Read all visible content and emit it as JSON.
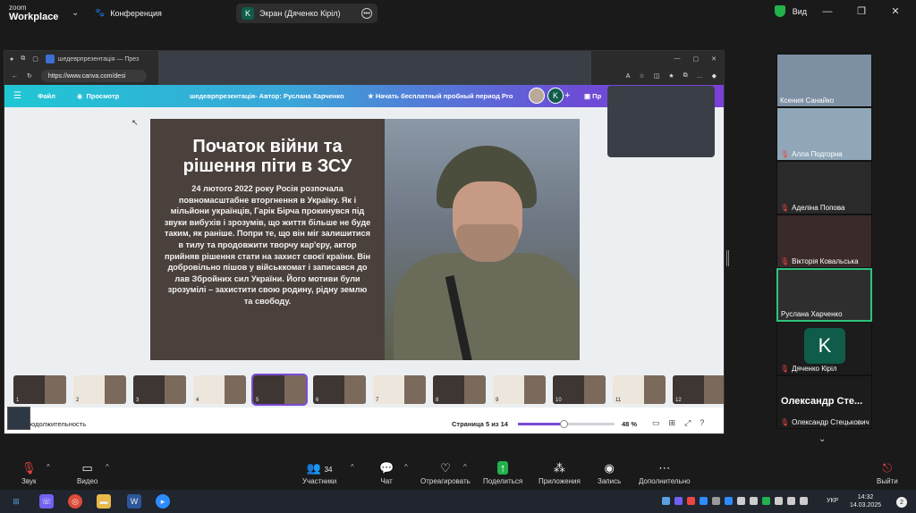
{
  "zoom": {
    "logo_top": "zoom",
    "logo_bottom": "Workplace",
    "meeting_label": "Конференция",
    "screen_share_label": "Экран (Дяченко Кіріл)",
    "screen_share_badge": "K",
    "view_label": "Вид"
  },
  "browser": {
    "tab_title": "шедеврпрезентація — През",
    "url": "https://www.canva.com/desi"
  },
  "canva": {
    "menu_file": "Файл",
    "menu_view": "Просмотр",
    "doc_title": "шедеврпрезентація- Автор: Руслана Харченко",
    "promo": "Начать бесплатный пробный период Pro",
    "avatar_letter": "K",
    "present_label": "Пр",
    "duration_label": "родолжительность",
    "page_indicator": "Страница 5 из 14",
    "zoom_value": 48,
    "zoom_label": "48 %"
  },
  "slide": {
    "title": "Початок війни та рішення піти в ЗСУ",
    "body": "24 лютого 2022 року Росія розпочала повномасштабне вторгнення в Україну. Як і мільйони українців, Гарік Бірча прокинувся під звуки вибухів і зрозумів, що життя більше не буде таким, як раніше. Попри те, що він міг залишитися в тилу та продовжити творчу кар'єру, актор прийняв рішення стати на захист своєї країни. Він добровільно пішов у військкомат і записався до лав Збройних сил України. Його мотиви були зрозумілі – захистити свою родину, рідну землю та свободу."
  },
  "thumbnails": [
    {
      "num": "1",
      "style": "dark"
    },
    {
      "num": "2",
      "style": "light"
    },
    {
      "num": "3",
      "style": "dark"
    },
    {
      "num": "4",
      "style": "light"
    },
    {
      "num": "5",
      "style": "dark",
      "selected": true
    },
    {
      "num": "6",
      "style": "dark"
    },
    {
      "num": "7",
      "style": "light"
    },
    {
      "num": "8",
      "style": "dark"
    },
    {
      "num": "9",
      "style": "light"
    },
    {
      "num": "10",
      "style": "dark"
    },
    {
      "num": "11",
      "style": "light"
    },
    {
      "num": "12",
      "style": "dark"
    }
  ],
  "participants": [
    {
      "name": "Ксения Санайко",
      "muted": false,
      "bg": "#7d8fa3"
    },
    {
      "name": "Алла Подгорна",
      "muted": true,
      "bg": "#8fa7b8"
    },
    {
      "name": "Аделіна Попова",
      "muted": true,
      "bg": "#2a2a2a"
    },
    {
      "name": "Вікторія Ковальська",
      "muted": true,
      "bg": "#3a2a2a"
    },
    {
      "name": "Руслана Харченко",
      "muted": false,
      "bg": "#2e2e2e",
      "active": true
    },
    {
      "name": "Дяченко Кіріл",
      "muted": true,
      "letter": "K"
    },
    {
      "name": "Олександр Стецькович",
      "muted": true,
      "big_label": "Олександр Сте..."
    }
  ],
  "toolbar": {
    "audio": "Звук",
    "video": "Видео",
    "participants": "Участники",
    "participants_count": "34",
    "chat": "Чат",
    "react": "Отреагировать",
    "share": "Поделиться",
    "apps": "Приложения",
    "record": "Запись",
    "more": "Дополнительно",
    "leave": "Выйти"
  },
  "taskbar": {
    "lang": "УКР",
    "time": "14:32",
    "date": "14.03.2025",
    "notifications": "2"
  }
}
